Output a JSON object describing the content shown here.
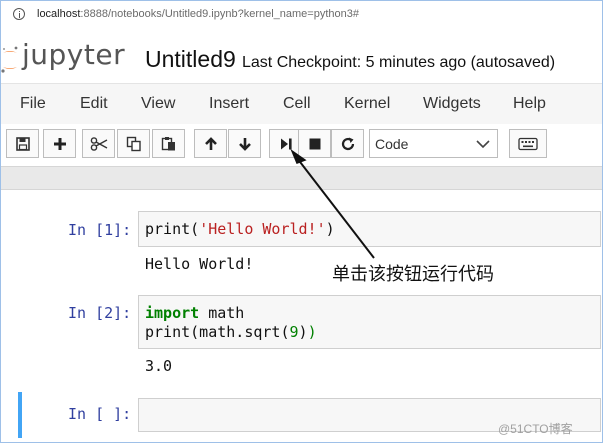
{
  "browser": {
    "url_host": "localhost",
    "url_rest": ":8888/notebooks/Untitled9.ipynb?kernel_name=python3#"
  },
  "header": {
    "logo_text": "jupyter",
    "notebook_title": "Untitled9",
    "checkpoint": "Last Checkpoint: 5 minutes ago (autosaved)"
  },
  "menu": {
    "items": [
      "File",
      "Edit",
      "View",
      "Insert",
      "Cell",
      "Kernel",
      "Widgets",
      "Help"
    ]
  },
  "toolbar": {
    "cell_type": "Code",
    "icons": [
      "save-icon",
      "plus-icon",
      "scissors-icon",
      "copy-icon",
      "paste-icon",
      "arrow-up-icon",
      "arrow-down-icon",
      "run-icon",
      "stop-icon",
      "restart-icon",
      "keyboard-icon"
    ]
  },
  "cells": [
    {
      "prompt": "In [1]:",
      "output": "Hello World!"
    },
    {
      "prompt": "In [2]:",
      "output": "3.0"
    },
    {
      "prompt": "In [ ]:"
    }
  ],
  "annotation": "单击该按钮运行代码",
  "watermark": "@51CTO博客",
  "colors": {
    "prompt": "#303f9f",
    "keyword": "#008000",
    "string": "#ba2121",
    "active_cell": "#42a5f5"
  }
}
